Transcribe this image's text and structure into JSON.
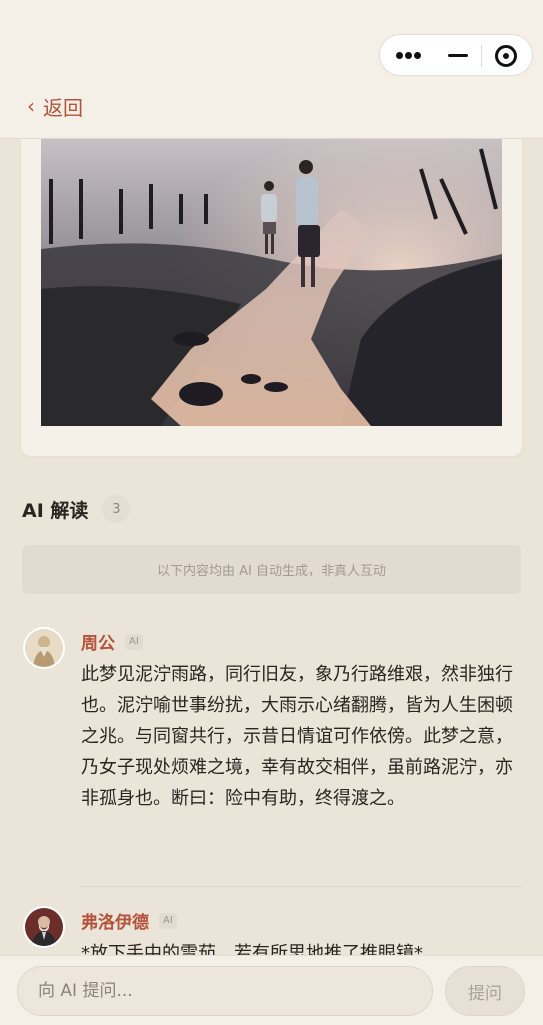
{
  "header": {
    "back_label": "返回",
    "back_icon": "chevron-left",
    "capsule_icons": [
      "more-dots-icon",
      "minimize-icon",
      "target-icon"
    ]
  },
  "dream_image": {
    "description_icon": "dream-illustration"
  },
  "section": {
    "title": "AI 解读",
    "count": "3"
  },
  "notice": "以下内容均由 AI 自动生成，非真人互动",
  "comments": [
    {
      "name": "周公",
      "tag": "AI",
      "text": "此梦见泥泞雨路，同行旧友，象乃行路维艰，然非独行也。泥泞喻世事纷扰，大雨示心绪翻腾，皆为人生困顿之兆。与同窗共行，示昔日情谊可作依傍。此梦之意，乃女子现处烦难之境，幸有故交相伴，虽前路泥泞，亦非孤身也。断曰：险中有助，终得渡之。"
    },
    {
      "name": "弗洛伊德",
      "tag": "AI",
      "text": "*放下手中的雪茄，若有所思地推了推眼镜*"
    }
  ],
  "footer": {
    "input_placeholder": "向 AI 提问...",
    "ask_label": "提问"
  },
  "colors": {
    "accent": "#b5523b",
    "background": "#ebe4d8",
    "card": "#f5f1e9"
  }
}
